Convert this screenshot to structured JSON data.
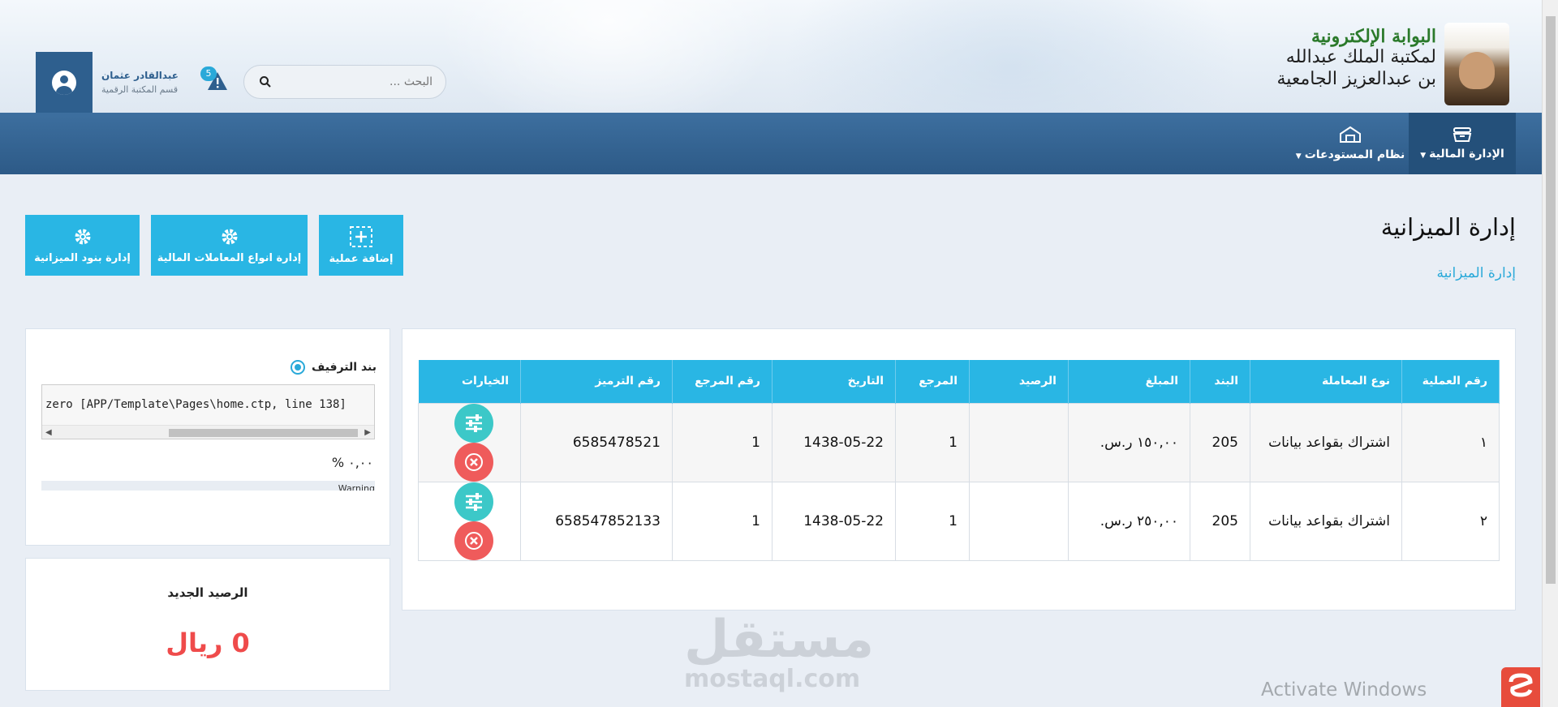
{
  "header": {
    "logo_line1": "البوابة الإلكترونية",
    "logo_line2": "لمكتبة الملك عبدالله",
    "logo_line3": "بن عبدالعزيز الجامعية",
    "user_name": "عبدالقادر عثمان",
    "user_department": "قسم المكتبة الرقمية",
    "notification_count": "5",
    "search_placeholder": "البحث ..."
  },
  "nav": {
    "items": [
      {
        "label": "الإدارة المالية",
        "icon": "inbox-icon",
        "active": true
      },
      {
        "label": "نظام المستودعات",
        "icon": "warehouse-icon",
        "active": false
      }
    ]
  },
  "page": {
    "title": "إدارة الميزانية",
    "breadcrumb": "إدارة الميزانية"
  },
  "actions": {
    "add_operation": "إضافة عملية",
    "manage_transaction_types": "إدارة انواع المعاملات المالية",
    "manage_budget_items": "إدارة بنود الميزانية"
  },
  "table": {
    "headers": [
      "رقم العملية",
      "نوع المعاملة",
      "البند",
      "المبلغ",
      "الرصيد",
      "المرجع",
      "التاريخ",
      "رقم المرجع",
      "رقم الترميز",
      "الخيارات"
    ],
    "rows": [
      {
        "id": "١",
        "type": "اشتراك بقواعد بيانات",
        "item": "205",
        "amount": "١٥٠,٠٠ ر.س.",
        "balance": "",
        "reference": "1",
        "date": "1438-05-22",
        "ref_no": "1",
        "code": "6585478521"
      },
      {
        "id": "٢",
        "type": "اشتراك بقواعد بيانات",
        "item": "205",
        "amount": "٢٥٠,٠٠ ر.س.",
        "balance": "",
        "reference": "1",
        "date": "1438-05-22",
        "ref_no": "1",
        "code": "658547852133"
      }
    ]
  },
  "sidebar": {
    "promotion_title": "بند الترفيف",
    "error_text": "zero [APP/Template\\Pages\\home.ctp, line 138]",
    "percent": "٠,٠٠ %",
    "progress_text": "Warning",
    "new_balance_label": "الرصيد الجديد",
    "new_balance_value": "0 ريال"
  },
  "watermark": {
    "arabic": "مستقل",
    "english": "mostaql.com",
    "activate": "Activate Windows"
  },
  "colors": {
    "primary": "#29b6e4",
    "navbar": "#2d5a87",
    "danger": "#ef5b5b",
    "edit": "#3cc8c8"
  }
}
